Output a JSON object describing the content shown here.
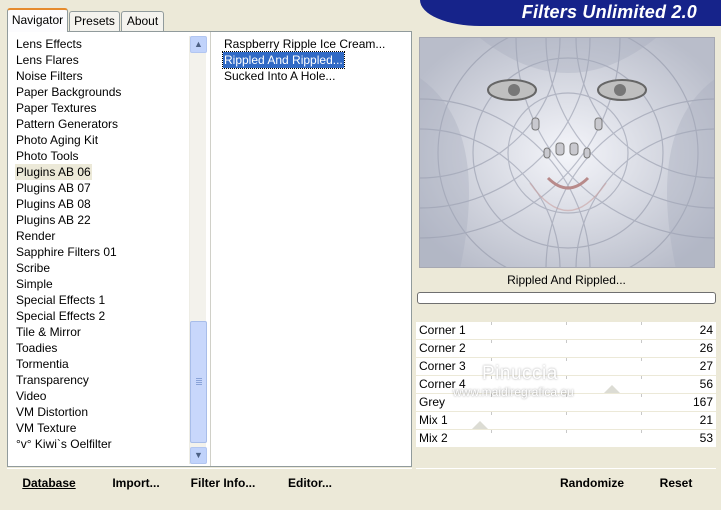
{
  "app": {
    "title": "Filters Unlimited 2.0"
  },
  "tabs": [
    {
      "label": "Navigator",
      "active": true
    },
    {
      "label": "Presets",
      "active": false
    },
    {
      "label": "About",
      "active": false
    }
  ],
  "categories": [
    "Lens Effects",
    "Lens Flares",
    "Noise Filters",
    "Paper Backgrounds",
    "Paper Textures",
    "Pattern Generators",
    "Photo Aging Kit",
    "Photo Tools",
    "Plugins AB 06",
    "Plugins AB 07",
    "Plugins AB 08",
    "Plugins AB 22",
    "Render",
    "Sapphire Filters 01",
    "Scribe",
    "Simple",
    "Special Effects 1",
    "Special Effects 2",
    "Tile & Mirror",
    "Toadies",
    "Tormentia",
    "Transparency",
    "Video",
    "VM Distortion",
    "VM Texture",
    "°v° Kiwi`s Oelfilter"
  ],
  "selected_category": "Plugins AB 06",
  "filters": [
    "Raspberry Ripple Ice Cream...",
    "Rippled And Rippled...",
    "Sucked Into A Hole..."
  ],
  "selected_filter": "Rippled And Rippled...",
  "preview": {
    "filter_name": "Rippled And Rippled..."
  },
  "parameters": [
    {
      "name": "Corner 1",
      "value": 24
    },
    {
      "name": "Corner 2",
      "value": 26
    },
    {
      "name": "Corner 3",
      "value": 27
    },
    {
      "name": "Corner 4",
      "value": 56
    },
    {
      "name": "Grey",
      "value": 167
    },
    {
      "name": "Mix 1",
      "value": 21
    },
    {
      "name": "Mix 2",
      "value": 53
    }
  ],
  "watermark": {
    "name": "Pinuccia",
    "url": "www.maidiregrafica.eu"
  },
  "buttons": {
    "database": "Database",
    "import": "Import...",
    "filter_info": "Filter Info...",
    "editor": "Editor...",
    "randomize": "Randomize",
    "reset": "Reset"
  },
  "colors": {
    "banner": "#16238a",
    "selection": "#316ac5",
    "active_tab": "#e68b2c"
  }
}
